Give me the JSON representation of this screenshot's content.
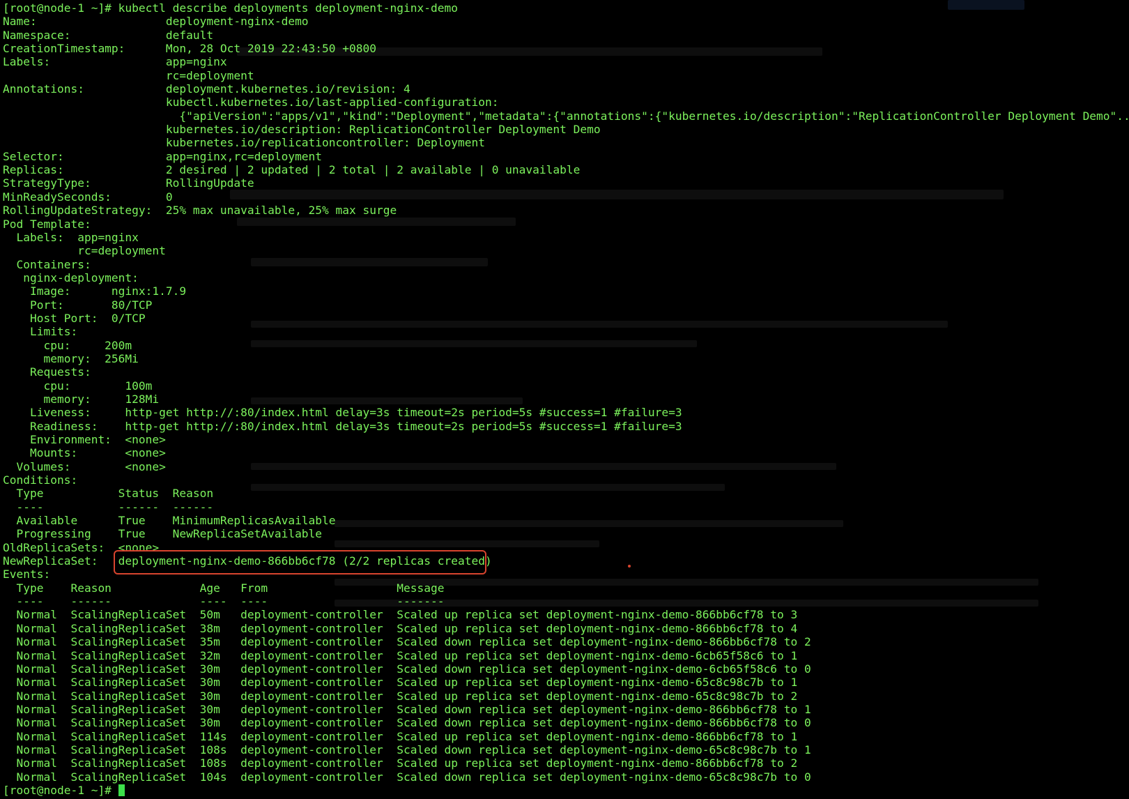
{
  "terminal": {
    "text_color": "#7cf25c",
    "background": "#000000",
    "highlight_color": "#d8442e",
    "prompt": "[root@node-1 ~]# ",
    "lines": [
      "[root@node-1 ~]# kubectl describe deployments deployment-nginx-demo",
      "Name:                   deployment-nginx-demo",
      "Namespace:              default",
      "CreationTimestamp:      Mon, 28 Oct 2019 22:43:50 +0800",
      "Labels:                 app=nginx",
      "                        rc=deployment",
      "Annotations:            deployment.kubernetes.io/revision: 4",
      "                        kubectl.kubernetes.io/last-applied-configuration:",
      "                          {\"apiVersion\":\"apps/v1\",\"kind\":\"Deployment\",\"metadata\":{\"annotations\":{\"kubernetes.io/description\":\"ReplicationController Deployment Demo\"...",
      "                        kubernetes.io/description: ReplicationController Deployment Demo",
      "                        kubernetes.io/replicationcontroller: Deployment",
      "Selector:               app=nginx,rc=deployment",
      "Replicas:               2 desired | 2 updated | 2 total | 2 available | 0 unavailable",
      "StrategyType:           RollingUpdate",
      "MinReadySeconds:        0",
      "RollingUpdateStrategy:  25% max unavailable, 25% max surge",
      "Pod Template:",
      "  Labels:  app=nginx",
      "           rc=deployment",
      "  Containers:",
      "   nginx-deployment:",
      "    Image:      nginx:1.7.9",
      "    Port:       80/TCP",
      "    Host Port:  0/TCP",
      "    Limits:",
      "      cpu:     200m",
      "      memory:  256Mi",
      "    Requests:",
      "      cpu:        100m",
      "      memory:     128Mi",
      "    Liveness:     http-get http://:80/index.html delay=3s timeout=2s period=5s #success=1 #failure=3",
      "    Readiness:    http-get http://:80/index.html delay=3s timeout=2s period=5s #success=1 #failure=3",
      "    Environment:  <none>",
      "    Mounts:       <none>",
      "  Volumes:        <none>",
      "Conditions:",
      "  Type           Status  Reason",
      "  ----           ------  ------",
      "  Available      True    MinimumReplicasAvailable",
      "  Progressing    True    NewReplicaSetAvailable",
      "OldReplicaSets:  <none>",
      "NewReplicaSet:   deployment-nginx-demo-866bb6cf78 (2/2 replicas created)",
      "Events:",
      "  Type    Reason             Age   From                   Message",
      "  ----    ------             ----  ----                   -------",
      "  Normal  ScalingReplicaSet  50m   deployment-controller  Scaled up replica set deployment-nginx-demo-866bb6cf78 to 3",
      "  Normal  ScalingReplicaSet  38m   deployment-controller  Scaled up replica set deployment-nginx-demo-866bb6cf78 to 4",
      "  Normal  ScalingReplicaSet  35m   deployment-controller  Scaled down replica set deployment-nginx-demo-866bb6cf78 to 2",
      "  Normal  ScalingReplicaSet  32m   deployment-controller  Scaled up replica set deployment-nginx-demo-6cb65f58c6 to 1",
      "  Normal  ScalingReplicaSet  30m   deployment-controller  Scaled down replica set deployment-nginx-demo-6cb65f58c6 to 0",
      "  Normal  ScalingReplicaSet  30m   deployment-controller  Scaled up replica set deployment-nginx-demo-65c8c98c7b to 1",
      "  Normal  ScalingReplicaSet  30m   deployment-controller  Scaled up replica set deployment-nginx-demo-65c8c98c7b to 2",
      "  Normal  ScalingReplicaSet  30m   deployment-controller  Scaled down replica set deployment-nginx-demo-866bb6cf78 to 1",
      "  Normal  ScalingReplicaSet  30m   deployment-controller  Scaled down replica set deployment-nginx-demo-866bb6cf78 to 0",
      "  Normal  ScalingReplicaSet  114s  deployment-controller  Scaled up replica set deployment-nginx-demo-866bb6cf78 to 1",
      "  Normal  ScalingReplicaSet  108s  deployment-controller  Scaled down replica set deployment-nginx-demo-65c8c98c7b to 1",
      "  Normal  ScalingReplicaSet  108s  deployment-controller  Scaled up replica set deployment-nginx-demo-866bb6cf78 to 2",
      "  Normal  ScalingReplicaSet  104s  deployment-controller  Scaled down replica set deployment-nginx-demo-65c8c98c7b to 0"
    ]
  }
}
